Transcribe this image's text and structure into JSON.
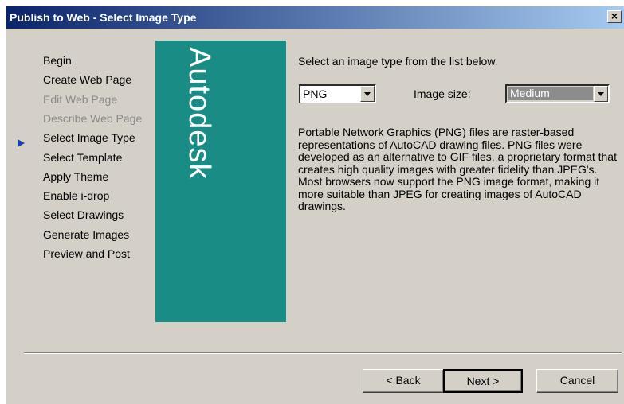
{
  "window": {
    "title": "Publish to Web - Select Image Type",
    "close_label": "×"
  },
  "steps": [
    {
      "label": "Begin",
      "enabled": true
    },
    {
      "label": "Create Web Page",
      "enabled": true
    },
    {
      "label": "Edit Web Page",
      "enabled": false
    },
    {
      "label": "Describe Web Page",
      "enabled": false
    },
    {
      "label": "Select Image Type",
      "enabled": true,
      "current": true
    },
    {
      "label": "Select Template",
      "enabled": true
    },
    {
      "label": "Apply Theme",
      "enabled": true
    },
    {
      "label": "Enable i-drop",
      "enabled": true
    },
    {
      "label": "Select Drawings",
      "enabled": true
    },
    {
      "label": "Generate Images",
      "enabled": true
    },
    {
      "label": "Preview and Post",
      "enabled": true
    }
  ],
  "logo": {
    "text": "Autodesk",
    "background": "#1a8c86"
  },
  "main": {
    "instruction": "Select an image type from the list below.",
    "image_type_value": "PNG",
    "image_size_label": "Image size:",
    "image_size_value": "Medium",
    "description": "Portable Network Graphics (PNG) files are raster-based representations of AutoCAD drawing files.  PNG files were developed as an alternative to GIF files, a proprietary format that creates high quality images with greater fidelity than JPEG's.  Most browsers now support the PNG image format, making it more suitable than JPEG for creating images of AutoCAD drawings."
  },
  "buttons": {
    "back": "< Back",
    "next": "Next >",
    "cancel": "Cancel"
  },
  "colors": {
    "title_bar_start": "#0a246a",
    "title_bar_end": "#a6caf0",
    "dialog_bg": "#d4d0c8",
    "current_step_arrow": "#1a3fb0"
  }
}
